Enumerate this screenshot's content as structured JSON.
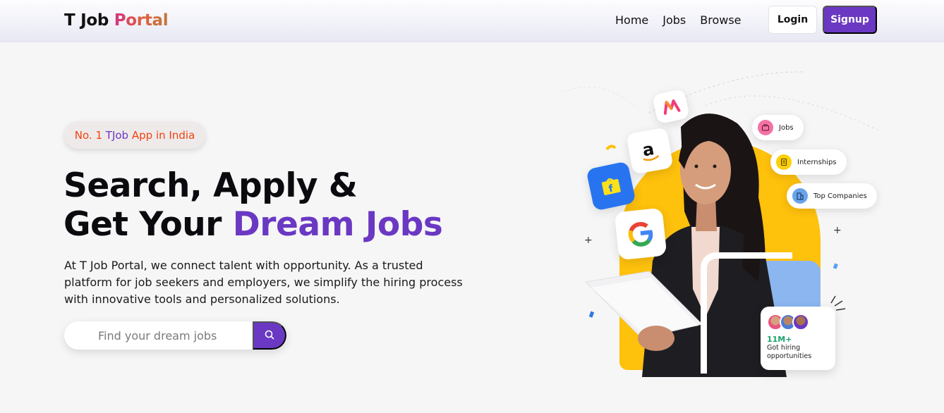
{
  "nav": {
    "brand_first": "T Job ",
    "brand_second": "Portal",
    "links": [
      "Home",
      "Jobs",
      "Browse"
    ],
    "login_label": "Login",
    "signup_label": "Signup"
  },
  "hero": {
    "badge_prefix": "No. 1 ",
    "badge_highlight": "TJob",
    "badge_suffix": " App in India",
    "headline_line1": "Search, Apply &",
    "headline_line2_start": "Get Your ",
    "headline_line2_accent": "Dream Jobs",
    "description": "At T Job Portal, we connect talent with opportunity. As a trusted platform for job seekers and employers, we simplify the hiring process with innovative tools and personalized solutions.",
    "search_placeholder": "Find your dream jobs"
  },
  "illustration": {
    "pills": [
      "Jobs",
      "Internships",
      "Top Companies"
    ],
    "stat_number": "11M+",
    "stat_text": "Got hiring opportunities"
  },
  "colors": {
    "accent": "#6a38c2",
    "badge_text": "#f0420f",
    "arch": "#fec10c"
  },
  "icons": [
    "search-icon",
    "myntra-logo-icon",
    "amazon-logo-icon",
    "flipkart-logo-icon",
    "google-logo-icon",
    "briefcase-icon",
    "document-icon",
    "building-icon"
  ]
}
